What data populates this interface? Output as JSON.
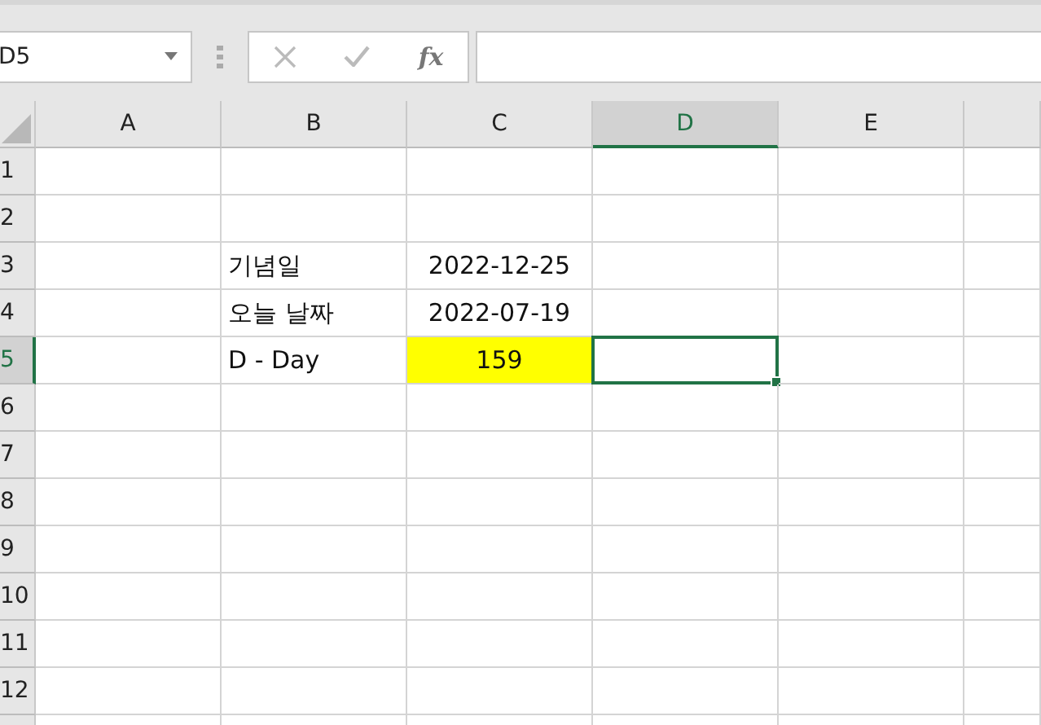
{
  "name_box": {
    "value": "D5"
  },
  "formula_bar": {
    "function_label": "fx"
  },
  "columns": [
    {
      "label": "A",
      "selected": false
    },
    {
      "label": "B",
      "selected": false
    },
    {
      "label": "C",
      "selected": false
    },
    {
      "label": "D",
      "selected": true
    },
    {
      "label": "E",
      "selected": false
    }
  ],
  "rows": [
    {
      "label": "1",
      "selected": false,
      "cells": {}
    },
    {
      "label": "2",
      "selected": false,
      "cells": {}
    },
    {
      "label": "3",
      "selected": false,
      "cells": {
        "B": {
          "text": "기념일"
        },
        "C": {
          "text": "2022-12-25"
        }
      }
    },
    {
      "label": "4",
      "selected": false,
      "cells": {
        "B": {
          "text": "오늘 날짜"
        },
        "C": {
          "text": "2022-07-19"
        }
      }
    },
    {
      "label": "5",
      "selected": true,
      "cells": {
        "B": {
          "text": "D - Day"
        },
        "C": {
          "text": "159",
          "color": "#ffff00"
        }
      }
    },
    {
      "label": "6",
      "selected": false,
      "cells": {}
    },
    {
      "label": "7",
      "selected": false,
      "cells": {}
    },
    {
      "label": "8",
      "selected": false,
      "cells": {}
    },
    {
      "label": "9",
      "selected": false,
      "cells": {}
    },
    {
      "label": "10",
      "selected": false,
      "cells": {}
    },
    {
      "label": "11",
      "selected": false,
      "cells": {}
    },
    {
      "label": "12",
      "selected": false,
      "cells": {}
    }
  ]
}
